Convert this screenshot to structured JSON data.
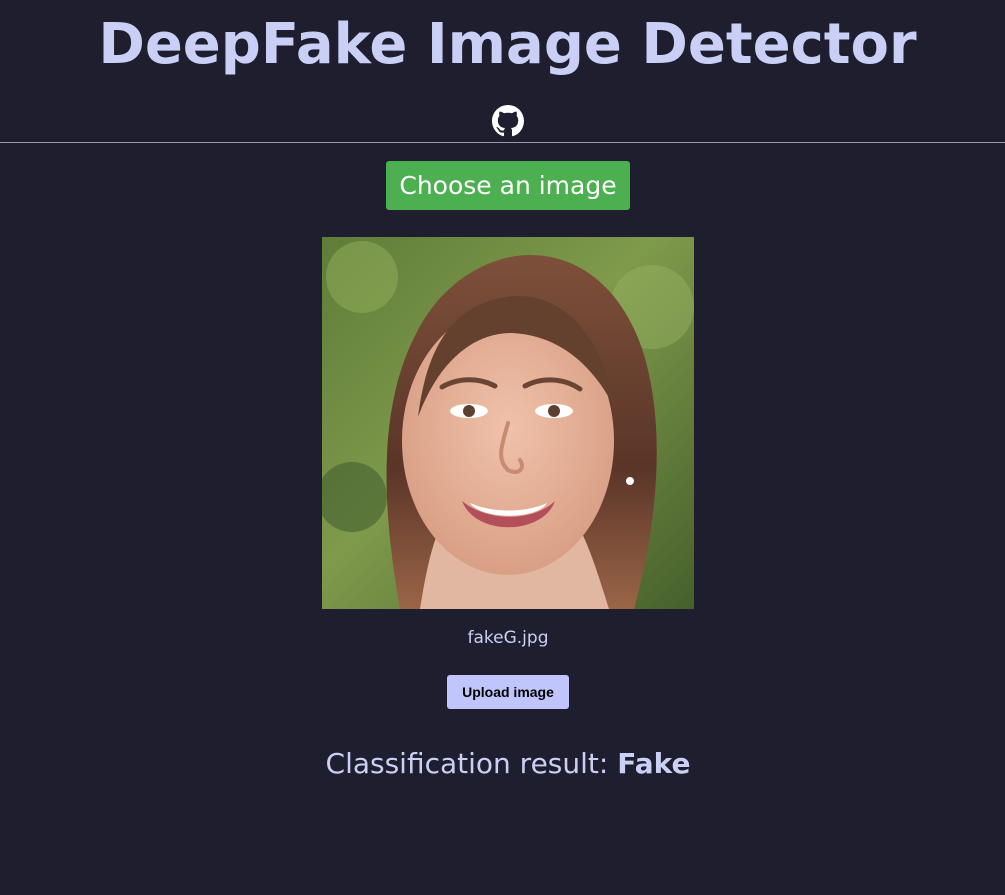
{
  "header": {
    "title": "DeepFake Image Detector",
    "github_icon": "github-icon"
  },
  "controls": {
    "choose_label": "Choose an image",
    "upload_label": "Upload image"
  },
  "preview": {
    "filename": "fakeG.jpg"
  },
  "result": {
    "label": "Classification result: ",
    "value": "Fake"
  },
  "colors": {
    "background": "#1e1e2e",
    "title_text": "#c9cff5",
    "choose_button": "#4caf50",
    "upload_button": "#c0c5fb"
  }
}
